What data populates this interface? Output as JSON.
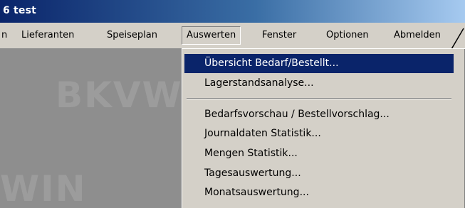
{
  "window": {
    "title": "6 test"
  },
  "menubar": {
    "items": [
      {
        "label": "n"
      },
      {
        "label": "Lieferanten"
      },
      {
        "label": "Speiseplan"
      },
      {
        "label": "Auswerten"
      },
      {
        "label": "Fenster"
      },
      {
        "label": "Optionen"
      },
      {
        "label": "Abmelden"
      }
    ]
  },
  "background": {
    "watermarks": [
      "BKVWI",
      "WIN"
    ]
  },
  "auswerten_menu": {
    "items": [
      {
        "label": "Übersicht Bedarf/Bestellt..."
      },
      {
        "label": "Lagerstandsanalyse..."
      },
      {
        "label": "Bedarfsvorschau / Bestellvorschlag..."
      },
      {
        "label": "Journaldaten Statistik..."
      },
      {
        "label": "Mengen Statistik..."
      },
      {
        "label": "Tagesauswertung..."
      },
      {
        "label": "Monatsauswertung..."
      }
    ]
  },
  "colors": {
    "highlight": "#0a246a",
    "menu_bg": "#d4d0c8",
    "workspace_bg": "#8e8e8e"
  }
}
